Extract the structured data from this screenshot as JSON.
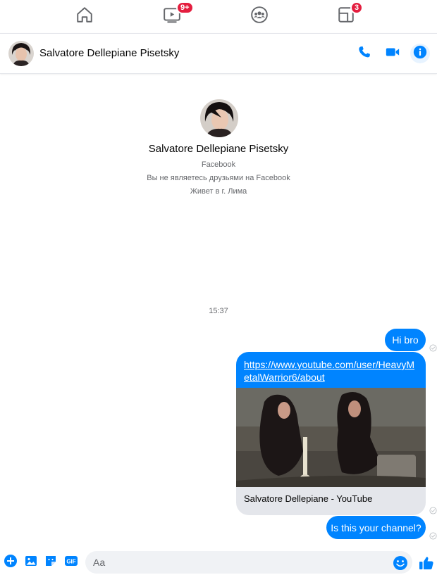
{
  "colors": {
    "accent": "#0084ff",
    "badge": "#e41e3f",
    "secondary_text": "#65676b"
  },
  "topnav": {
    "items": [
      {
        "icon": "home-icon"
      },
      {
        "icon": "watch-icon",
        "badge": "9+"
      },
      {
        "icon": "groups-icon"
      },
      {
        "icon": "gaming-icon",
        "badge": "3"
      }
    ]
  },
  "header": {
    "name": "Salvatore Dellepiane Pisetsky",
    "actions": [
      "phone-icon",
      "video-icon",
      "info-icon"
    ]
  },
  "intro": {
    "name": "Salvatore Dellepiane Pisetsky",
    "source": "Facebook",
    "friend_status": "Вы не являетесь друзьями на Facebook",
    "lives": "Живет в г. Лима"
  },
  "conversation": {
    "timestamp": "15:37",
    "messages": [
      {
        "text": "Hi bro"
      },
      {
        "link": "https://www.youtube.com/user/HeavyMetalWarrior6/about",
        "link_title": "Salvatore Dellepiane - YouTube"
      },
      {
        "text": "Is this your channel?"
      }
    ]
  },
  "composer": {
    "placeholder": "Aa",
    "icons": [
      "plus-icon",
      "photo-icon",
      "sticker-icon",
      "gif-icon",
      "emoji-icon",
      "like-icon"
    ]
  }
}
